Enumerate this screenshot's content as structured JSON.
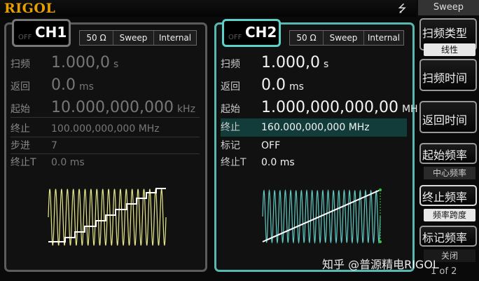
{
  "header": {
    "logo": "RIGOL",
    "usb_icon": "usb-icon"
  },
  "ch1": {
    "off_label": "OFF",
    "name": "CH1",
    "tags": [
      "50 Ω",
      "Sweep",
      "Internal"
    ],
    "params": [
      {
        "label": "扫频",
        "value": "1.000,0",
        "unit": "s"
      },
      {
        "label": "返回",
        "value": "0.0",
        "unit": "ms"
      },
      {
        "label": "起始",
        "value": "10.000,000,000",
        "unit": "kHz"
      }
    ],
    "params_small": [
      {
        "label": "终止",
        "value": "100.000,000,000 MHz"
      },
      {
        "label": "步进",
        "value": "7"
      },
      {
        "label": "终止T",
        "value": "0.0 ms"
      }
    ]
  },
  "ch2": {
    "off_label": "OFF",
    "name": "CH2",
    "tags": [
      "50 Ω",
      "Sweep",
      "Internal"
    ],
    "params": [
      {
        "label": "扫频",
        "value": "1.000,0",
        "unit": "s"
      },
      {
        "label": "返回",
        "value": "0.0",
        "unit": "ms"
      },
      {
        "label": "起始",
        "value": "1.000,000,000,00",
        "unit": "MHz"
      }
    ],
    "params_small": [
      {
        "label": "终止",
        "value": "160.000,000,000 MHz"
      },
      {
        "label": "标记",
        "value": "OFF"
      },
      {
        "label": "终止T",
        "value": "0.0 ms"
      }
    ]
  },
  "menu": {
    "title": "Sweep",
    "buttons": [
      {
        "label": "扫频类型",
        "sub": "线性"
      },
      {
        "label": "扫频时间"
      },
      {
        "label": "返回时间"
      },
      {
        "label": "起始频率",
        "sub": "中心频率"
      },
      {
        "label": "终止频率",
        "sub": "频率跨度"
      },
      {
        "label": "标记频率",
        "sub": "关闭"
      }
    ],
    "page": "1 of 2"
  },
  "watermark": "知乎 @普源精电RIGOL",
  "colors": {
    "ch1_wave": "#e6e68a",
    "ch2_wave": "#5fc8c0",
    "ch2_highlight": "#123c3a",
    "logo": "#e8a000"
  }
}
